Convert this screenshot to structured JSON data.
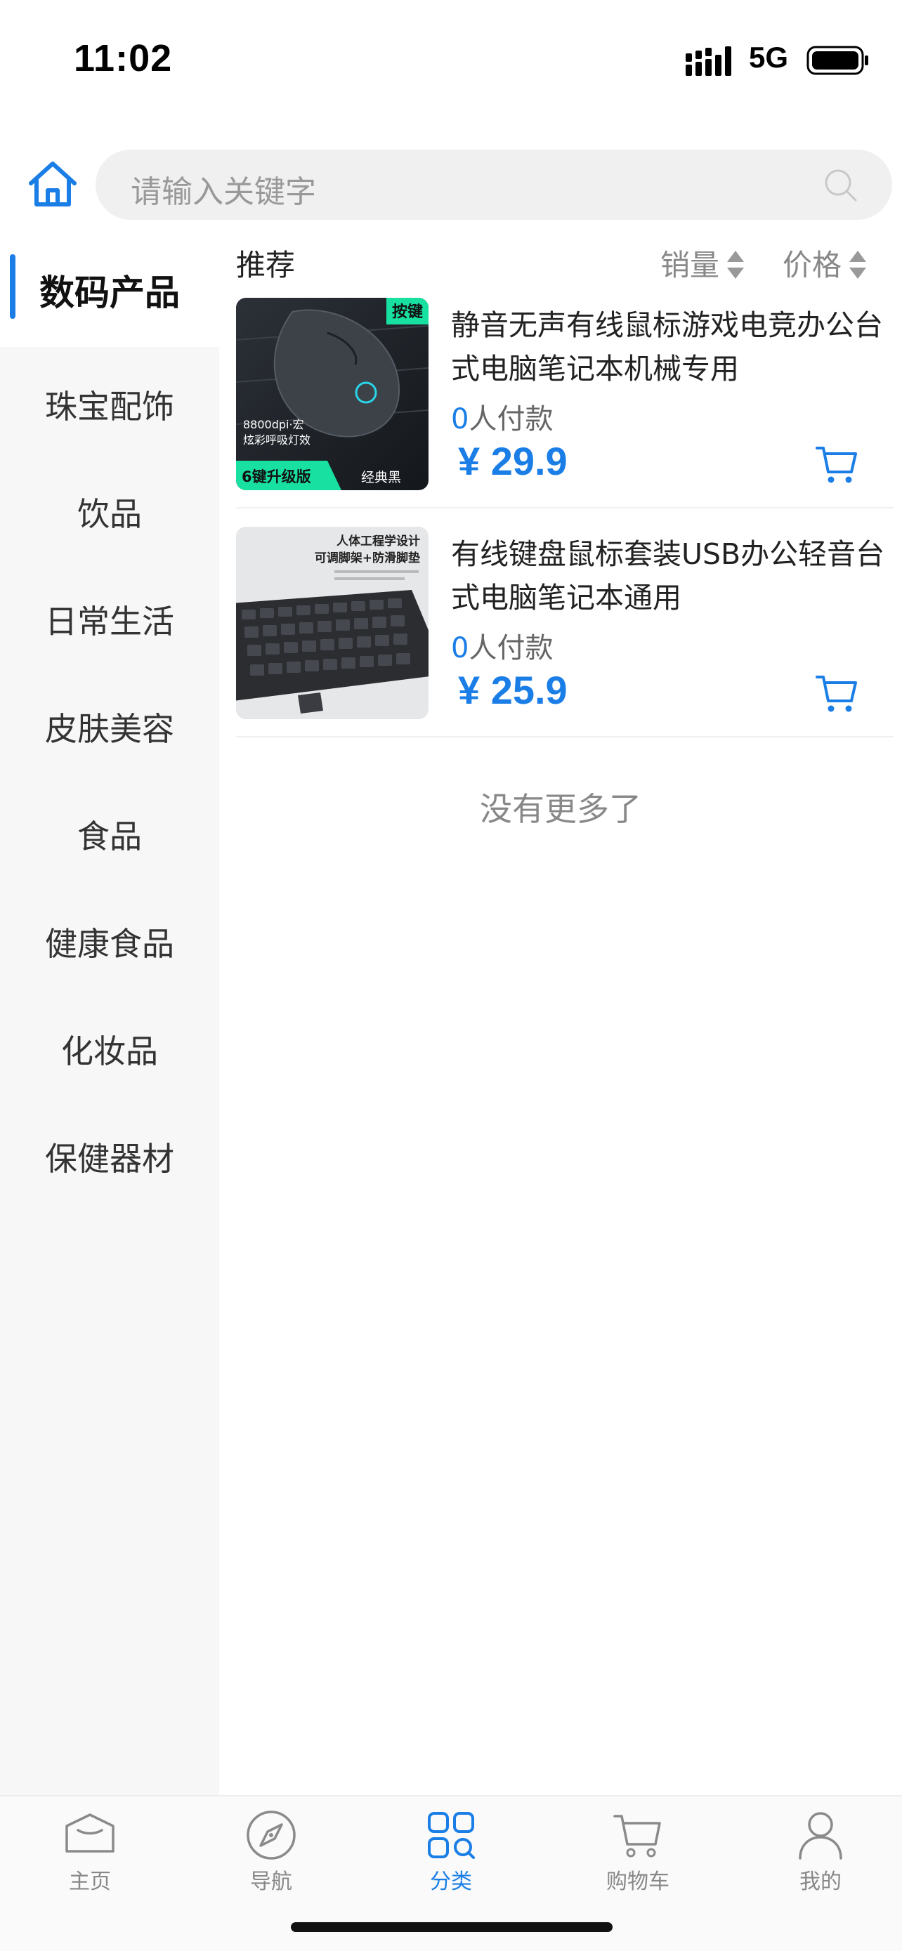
{
  "status_bar": {
    "time": "11:02",
    "network": "5G"
  },
  "search": {
    "placeholder": "请输入关键字"
  },
  "sidebar": {
    "items": [
      {
        "label": "数码产品",
        "active": true
      },
      {
        "label": "珠宝配饰"
      },
      {
        "label": "饮品"
      },
      {
        "label": "日常生活"
      },
      {
        "label": "皮肤美容"
      },
      {
        "label": "食品"
      },
      {
        "label": "健康食品"
      },
      {
        "label": "化妆品"
      },
      {
        "label": "保健器材"
      }
    ]
  },
  "sort_bar": {
    "recommend": "推荐",
    "sales": "销量",
    "price": "价格"
  },
  "products": [
    {
      "title": "静音无声有线鼠标游戏电竞办公台式电脑笔记本机械专用",
      "sold_count": "0",
      "sold_suffix": "人付款",
      "price": "¥ 29.9",
      "image_text": {
        "badge": "按键",
        "spec1": "8800dpi·宏",
        "spec2": "炫彩呼吸灯效",
        "tag_green": "6键升级版",
        "tag_dark": "经典黑"
      }
    },
    {
      "title": "有线键盘鼠标套装USB办公轻音台式电脑笔记本通用",
      "sold_count": "0",
      "sold_suffix": "人付款",
      "price": "¥ 25.9",
      "image_text": {
        "line1": "人体工程学设计",
        "line2": "可调脚架+防滑脚垫"
      }
    }
  ],
  "no_more": "没有更多了",
  "tabbar": {
    "tabs": [
      {
        "label": "主页",
        "icon": "home-hat-icon"
      },
      {
        "label": "导航",
        "icon": "compass-icon"
      },
      {
        "label": "分类",
        "icon": "category-grid-icon",
        "active": true
      },
      {
        "label": "购物车",
        "icon": "cart-icon"
      },
      {
        "label": "我的",
        "icon": "user-icon"
      }
    ]
  },
  "colors": {
    "accent": "#1a7ee6",
    "sidebar_bg": "#f7f7f7",
    "search_bg": "#f0f0f0"
  }
}
